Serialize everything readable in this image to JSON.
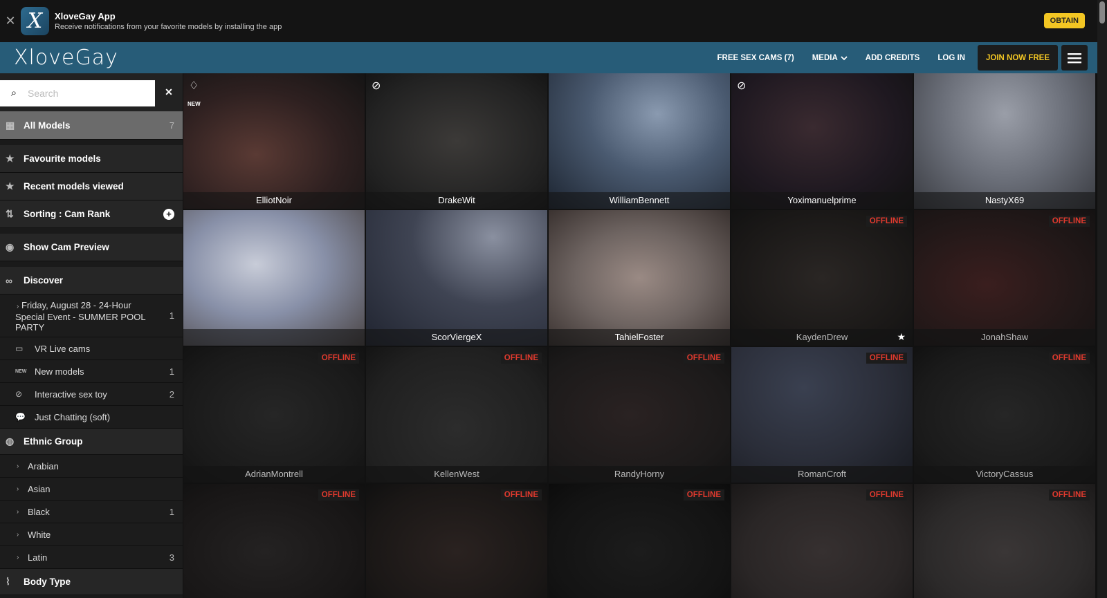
{
  "banner": {
    "title": "XloveGay App",
    "subtitle": "Receive notifications from your favorite models by installing the app",
    "obtain_label": "OBTAIN",
    "logo_letter": "X"
  },
  "nav": {
    "brand": "XloveGay",
    "free_cams": "FREE SEX CAMS (7)",
    "media": "MEDIA",
    "add_credits": "ADD CREDITS",
    "log_in": "LOG IN",
    "join": "JOIN NOW FREE"
  },
  "sidebar": {
    "search_placeholder": "Search",
    "main_items": [
      {
        "label": "All Models",
        "count": "7"
      },
      {
        "label": "Favourite models"
      },
      {
        "label": "Recent models viewed"
      },
      {
        "label": "Sorting : Cam Rank"
      },
      {
        "label": "Show Cam Preview"
      },
      {
        "label": "Discover"
      }
    ],
    "discover": [
      {
        "label": "Friday, August 28 - 24-Hour Special Event - SUMMER POOL PARTY",
        "count": "1"
      },
      {
        "label": "VR Live cams"
      },
      {
        "label": "New models",
        "count": "1",
        "tag": "NEW"
      },
      {
        "label": "Interactive sex toy",
        "count": "2"
      },
      {
        "label": "Just Chatting (soft)"
      }
    ],
    "ethnic_title": "Ethnic Group",
    "ethnic": [
      {
        "label": "Arabian"
      },
      {
        "label": "Asian"
      },
      {
        "label": "Black",
        "count": "1"
      },
      {
        "label": "White"
      },
      {
        "label": "Latin",
        "count": "3"
      }
    ],
    "body_title": "Body Type"
  },
  "grid": {
    "offline_label": "OFFLINE",
    "new_label": "NEW",
    "tiles": [
      {
        "name": "ElliotNoir",
        "color": "#3a2624"
      },
      {
        "name": "DrakeWit",
        "color": "#2c2a29"
      },
      {
        "name": "WilliamBennett",
        "color": "#4a5a70"
      },
      {
        "name": "Yoximanuelprime",
        "color": "#241c22"
      },
      {
        "name": "NastyX69",
        "color": "#6a6e78"
      },
      {
        "name": "ScorViergeX",
        "color": "#3f4453"
      },
      {
        "name": "TahielFoster",
        "color": "#6e6461"
      },
      {
        "name": "",
        "color": "#1e1c1b"
      },
      {
        "name": "",
        "color": "#231919"
      },
      {
        "name": "AdrianMontrell",
        "color": "#1d1d1d"
      },
      {
        "name": "KellenWest",
        "color": "#242424"
      },
      {
        "name": "RandyHorny",
        "color": "#1e1b1b"
      },
      {
        "name": "RomanCroft",
        "color": "#2a2d38"
      },
      {
        "name": "VictoryCassus",
        "color": "#1e1e1e"
      },
      {
        "name": "",
        "color": "#1a1818"
      },
      {
        "name": "",
        "color": "#1c1817"
      },
      {
        "name": "",
        "color": "#151515"
      },
      {
        "name": "",
        "color": "#2a2626"
      },
      {
        "name": "",
        "color": "#2c2a2a"
      }
    ]
  },
  "offline_tiles": {
    "kayden": "KaydenDrew",
    "jonah": "JonahShaw"
  }
}
